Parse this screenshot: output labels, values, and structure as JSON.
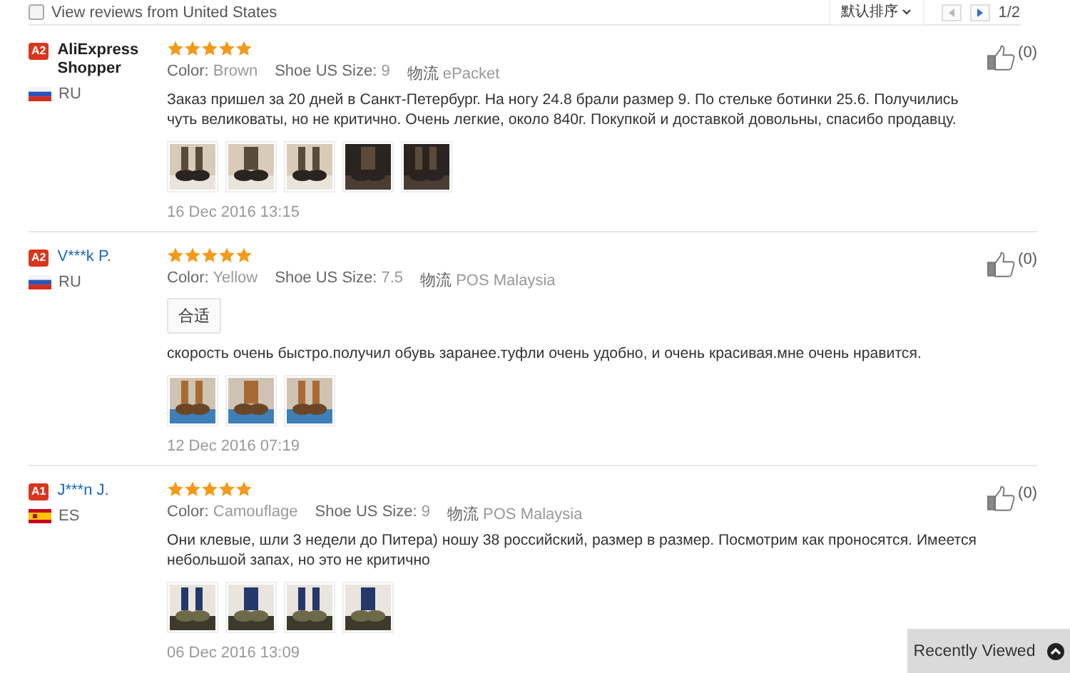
{
  "filter": {
    "label": "View reviews from United States",
    "checked": false
  },
  "sort": {
    "label": "默认排序"
  },
  "pager": {
    "text": "1/2"
  },
  "reviews": [
    {
      "badge": "A2",
      "name": "AliExpress Shopper",
      "linked": false,
      "flag": {
        "kind": "ru"
      },
      "country": "RU",
      "stars": 5,
      "meta": [
        {
          "label": "Color:",
          "value": "Brown"
        },
        {
          "label": "Shoe US Size:",
          "value": "9"
        },
        {
          "label": "物流",
          "value": "ePacket"
        }
      ],
      "text": "Заказ пришел за 20 дней в Санкт-Петербург. На ногу 24.8 брали размер 9. По стельке ботинки 25.6. Получились чуть великоваты, но не критично. Очень легкие, около 840г. Покупкой и доставкой довольны, спасибо продавцу.",
      "photos": [
        {
          "kind": "picture"
        },
        {
          "kind": "picture"
        },
        {
          "kind": "picture"
        },
        {
          "kind": "picture"
        },
        {
          "kind": "picture"
        }
      ],
      "date": "16 Dec 2016 13:15",
      "likes": "(0)"
    },
    {
      "badge": "A2",
      "name": "V***k P.",
      "linked": true,
      "flag": {
        "kind": "ru"
      },
      "country": "RU",
      "stars": 5,
      "meta": [
        {
          "label": "Color:",
          "value": "Yellow"
        },
        {
          "label": "Shoe US Size:",
          "value": "7.5"
        },
        {
          "label": "物流",
          "value": "POS Malaysia"
        }
      ],
      "tag": "合适",
      "text": "скорость очень быстро.получил обувь заранее.туфли очень удобно, и очень красивая.мне очень нравится.",
      "photos": [
        {
          "kind": "picture"
        },
        {
          "kind": "picture"
        },
        {
          "kind": "picture"
        }
      ],
      "date": "12 Dec 2016 07:19",
      "likes": "(0)"
    },
    {
      "badge": "A1",
      "name": "J***n J.",
      "linked": true,
      "flag": {
        "kind": "es"
      },
      "country": "ES",
      "stars": 5,
      "meta": [
        {
          "label": "Color:",
          "value": "Camouflage"
        },
        {
          "label": "Shoe US Size:",
          "value": "9"
        },
        {
          "label": "物流",
          "value": "POS Malaysia"
        }
      ],
      "text": "Они клевые, шли 3 недели до Питера) ношу 38 российский, размер в размер. Посмотрим как проносятся. Имеется небольшой запах, но это не критично",
      "photos": [
        {
          "kind": "picture"
        },
        {
          "kind": "picture"
        },
        {
          "kind": "picture"
        },
        {
          "kind": "picture"
        }
      ],
      "date": "06 Dec 2016 13:09",
      "likes": "(0)"
    }
  ],
  "recently_viewed": {
    "label": "Recently Viewed"
  }
}
